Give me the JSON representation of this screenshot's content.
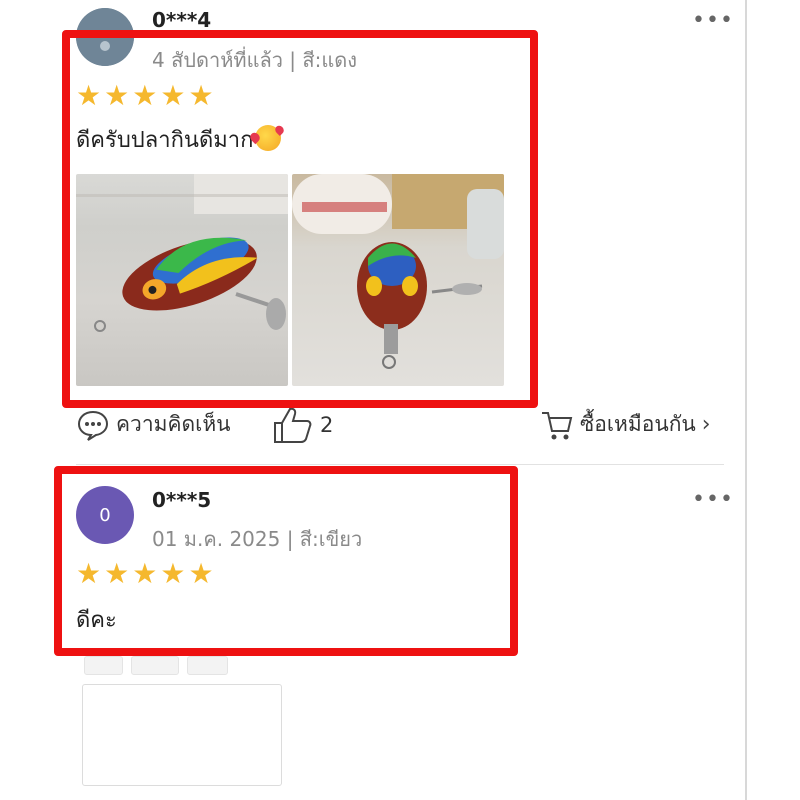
{
  "reviews": [
    {
      "username": "0***4",
      "meta": "4 สัปดาห์ที่แล้ว | สี:แดง",
      "rating": 5,
      "text": "ดีครับปลากินดีมาก",
      "photos": [
        "fishing-lure-photo-1",
        "fishing-lure-photo-2"
      ],
      "actions": {
        "comment_label": "ความคิดเห็น",
        "like_count": "2",
        "buy_label": "ซื้อเหมือนกัน"
      }
    },
    {
      "avatar_letter": "0",
      "username": "0***5",
      "meta": "01 ม.ค. 2025 | สี:เขียว",
      "rating": 5,
      "text": "ดีคะ"
    }
  ],
  "icons": {
    "more": "more-horizontal-icon",
    "star": "star-icon",
    "comment": "comment-bubble-icon",
    "like": "thumbs-up-icon",
    "cart": "shopping-cart-icon",
    "chevron": "chevron-right-icon"
  },
  "colors": {
    "star": "#f5b82e",
    "highlight": "#ee1111",
    "avatar_1": "#6f8597",
    "avatar_2": "#6a58b3"
  }
}
